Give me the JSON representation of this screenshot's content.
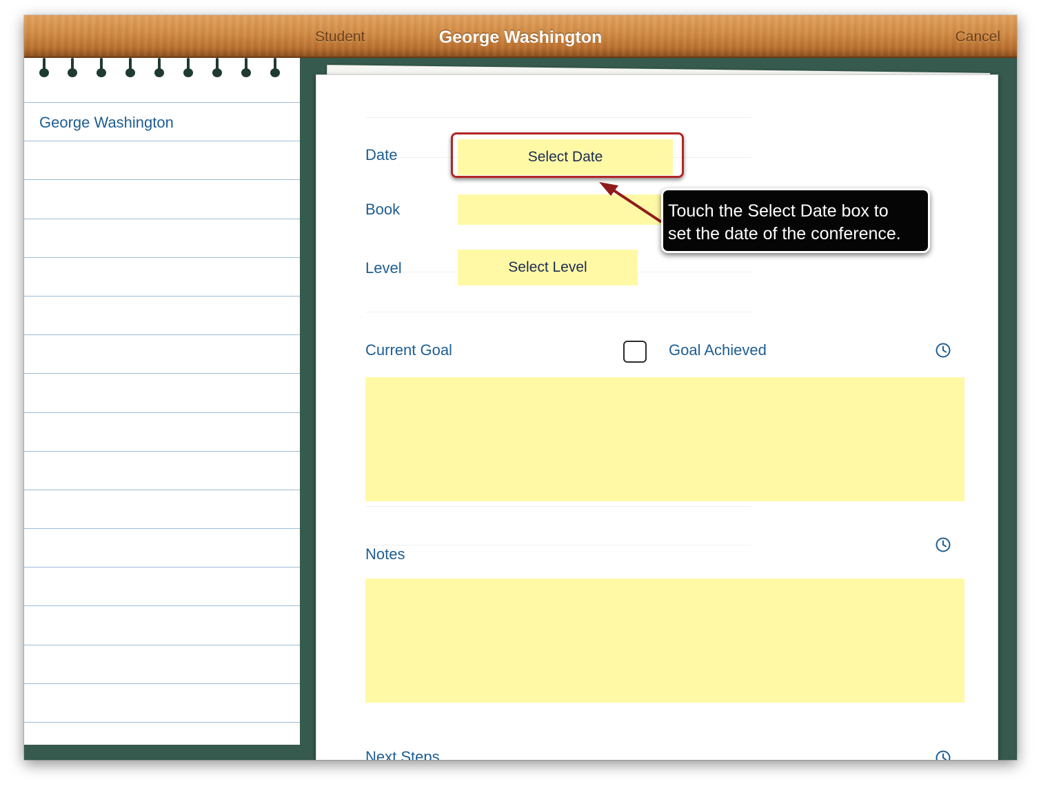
{
  "navbar": {
    "back_label": "Student",
    "title": "George Washington",
    "cancel_label": "Cancel"
  },
  "sidebar": {
    "items": [
      {
        "label": "George Washington"
      }
    ]
  },
  "form": {
    "date_label": "Date",
    "date_button": "Select Date",
    "book_label": "Book",
    "book_value": "",
    "level_label": "Level",
    "level_button": "Select Level",
    "current_goal_label": "Current Goal",
    "goal_achieved_label": "Goal Achieved",
    "goal_achieved_checked": false,
    "current_goal_text": "",
    "notes_label": "Notes",
    "notes_text": "",
    "next_steps_label": "Next Steps"
  },
  "callout": {
    "text_line1": "Touch the Select Date box to",
    "text_line2": "set the date of the conference."
  },
  "colors": {
    "wood": "#d08a44",
    "board_green": "#365a4d",
    "label_blue": "#1d5d92",
    "field_yellow": "#fff9a6",
    "highlight_red": "#b22525"
  }
}
